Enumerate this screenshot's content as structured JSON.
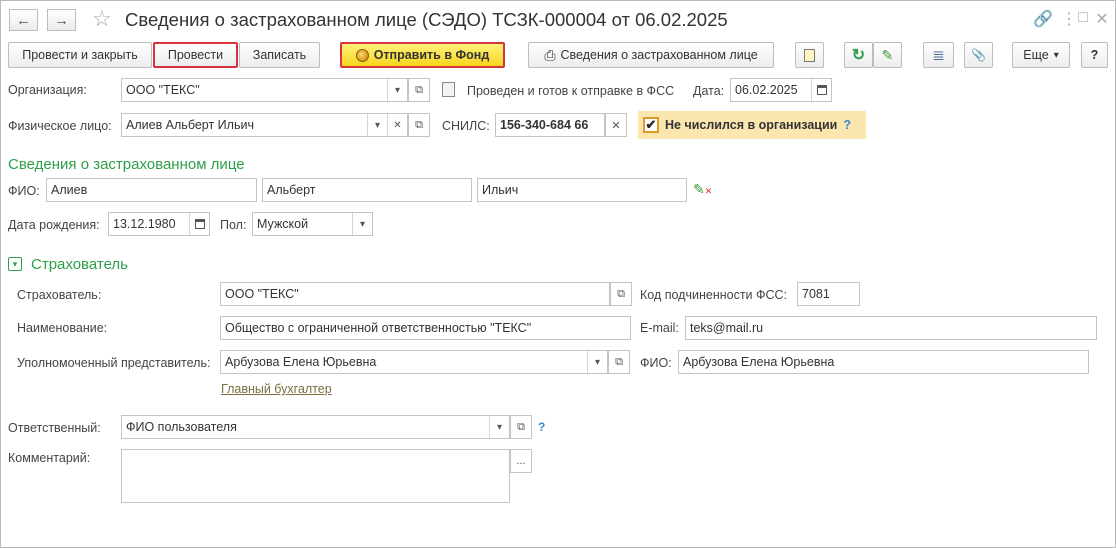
{
  "window": {
    "title": "Сведения о застрахованном лице (СЭДО) ТСЗК-000004 от 06.02.2025",
    "back_glyph": "←",
    "forward_glyph": "→",
    "star_glyph": "☆",
    "link_glyph": "🔗",
    "menu_glyph": "⋮",
    "restore_glyph": "□",
    "close_glyph": "✕"
  },
  "toolbar": {
    "post_and_close": "Провести и закрыть",
    "post": "Провести",
    "save": "Записать",
    "send_to_fund": "Отправить в Фонд",
    "insured_info": "Сведения о застрахованном лице",
    "more": "Еще",
    "help": "?",
    "more_arrow": "▾",
    "refresh_glyph": "↻",
    "clear_glyph": "✎",
    "list_glyph": "≣",
    "clip_glyph": "📎",
    "print_glyph": "⎙"
  },
  "header": {
    "org_label": "Организация:",
    "org_value": "ООО \"ТЕКС\"",
    "status_text": "Проведен и готов к отправке в ФСС",
    "date_label": "Дата:",
    "date_value": "06.02.2025",
    "person_label": "Физическое лицо:",
    "person_value": "Алиев Альберт Ильич",
    "snils_label": "СНИЛС:",
    "snils_value": "156-340-684 66",
    "not_employed_label": "Не числился в организации",
    "not_employed_checked": true,
    "help_q": "?"
  },
  "insured": {
    "section_title": "Сведения о застрахованном лице",
    "fio_label": "ФИО:",
    "last_name": "Алиев",
    "first_name": "Альберт",
    "middle_name": "Ильич",
    "birth_label": "Дата рождения:",
    "birth_value": "13.12.1980",
    "sex_label": "Пол:",
    "sex_value": "Мужской"
  },
  "insurer": {
    "section_title": "Страхователь",
    "insurer_label": "Страхователь:",
    "insurer_value": "ООО \"ТЕКС\"",
    "fss_code_label": "Код подчиненности ФСС:",
    "fss_code_value": "7081",
    "name_label": "Наименование:",
    "name_value": "Общество с ограниченной ответственностью \"ТЕКС\"",
    "email_label": "E-mail:",
    "email_value": "teks@mail.ru",
    "rep_label": "Уполномоченный представитель:",
    "rep_value": "Арбузова Елена Юрьевна",
    "rep_fio_label": "ФИО:",
    "rep_fio_value": "Арбузова Елена Юрьевна",
    "rep_link": "Главный бухгалтер"
  },
  "footer": {
    "responsible_label": "Ответственный:",
    "responsible_value": "ФИО пользователя",
    "comment_label": "Комментарий:",
    "comment_value": "",
    "help_q": "?",
    "ellipsis": "..."
  }
}
